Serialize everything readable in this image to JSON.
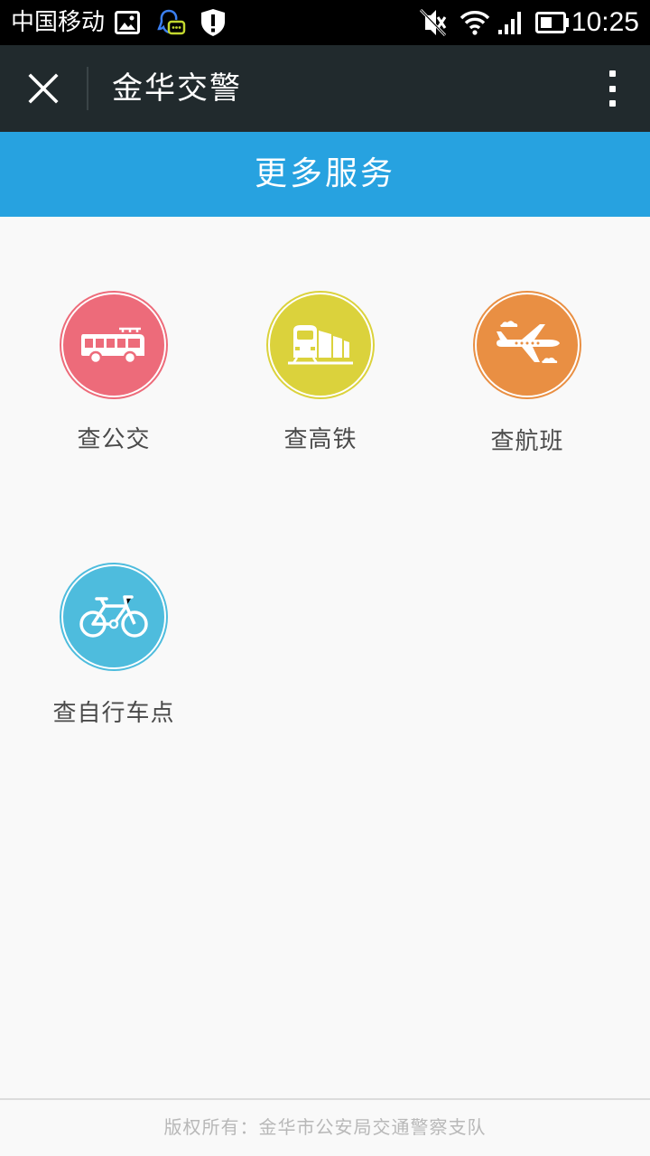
{
  "status_bar": {
    "carrier": "中国移动",
    "time": "10:25",
    "icons": [
      "gallery-icon",
      "qq-message-icon",
      "shield-icon",
      "silent-mode-icon",
      "wifi-icon",
      "signal-icon",
      "battery-icon"
    ]
  },
  "app_bar": {
    "title": "金华交警",
    "close_icon": "close-icon",
    "menu_icon": "more-vertical-icon"
  },
  "section": {
    "title": "更多服务"
  },
  "services": [
    {
      "label": "查公交",
      "icon": "bus-icon",
      "color": "#ed6b7a"
    },
    {
      "label": "查高铁",
      "icon": "train-icon",
      "color": "#dbd23c"
    },
    {
      "label": "查航班",
      "icon": "airplane-icon",
      "color": "#e98f43"
    },
    {
      "label": "查自行车点",
      "icon": "bicycle-icon",
      "color": "#4ebcdd"
    }
  ],
  "footer": {
    "text": "版权所有：金华市公安局交通警察支队"
  },
  "colors": {
    "status_bar": "#000000",
    "app_bar": "#212a2d",
    "accent": "#27a2e0",
    "background": "#f9f9f9"
  }
}
